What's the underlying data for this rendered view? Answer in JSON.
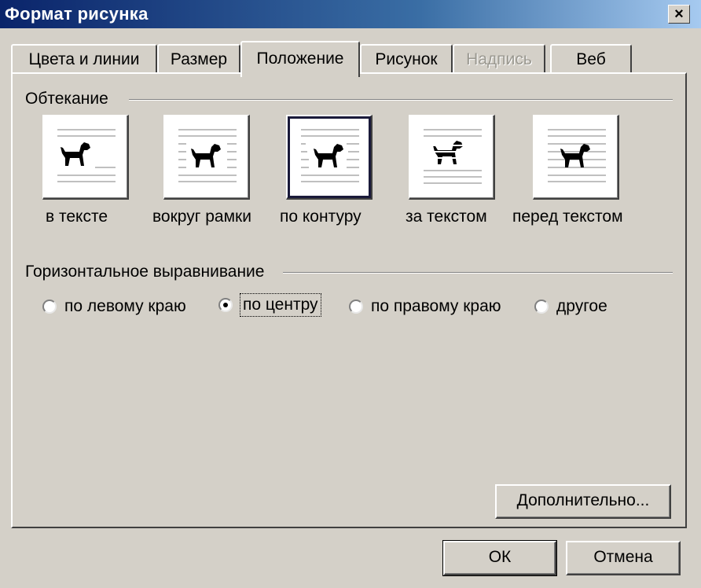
{
  "window": {
    "title": "Формат рисунка",
    "close_glyph": "×"
  },
  "tabs": [
    {
      "label": "Цвета и линии",
      "state": "normal"
    },
    {
      "label": "Размер",
      "state": "normal"
    },
    {
      "label": "Положение",
      "state": "active"
    },
    {
      "label": "Рисунок",
      "state": "normal"
    },
    {
      "label": "Надпись",
      "state": "disabled"
    },
    {
      "label": "Веб",
      "state": "normal"
    }
  ],
  "wrapping": {
    "group_label": "Обтекание",
    "options": [
      {
        "label": "в тексте",
        "icon": "wrap-inline-icon",
        "selected": false
      },
      {
        "label": "вокруг рамки",
        "icon": "wrap-square-icon",
        "selected": false
      },
      {
        "label": "по контуру",
        "icon": "wrap-tight-icon",
        "selected": true
      },
      {
        "label": "за текстом",
        "icon": "wrap-behind-text-icon",
        "selected": false
      },
      {
        "label": "перед текстом",
        "icon": "wrap-in-front-of-text-icon",
        "selected": false
      }
    ]
  },
  "alignment": {
    "group_label": "Горизонтальное выравнивание",
    "options": [
      {
        "label": "по левому краю",
        "checked": false
      },
      {
        "label": "по центру",
        "checked": true
      },
      {
        "label": "по правому краю",
        "checked": false
      },
      {
        "label": "другое",
        "checked": false
      }
    ]
  },
  "buttons": {
    "advanced": "Дополнительно...",
    "ok": "ОК",
    "cancel": "Отмена"
  },
  "colors": {
    "titlebar_start": "#0a246a",
    "titlebar_end": "#a6caf0",
    "dialog_bg": "#d4d0c8"
  }
}
